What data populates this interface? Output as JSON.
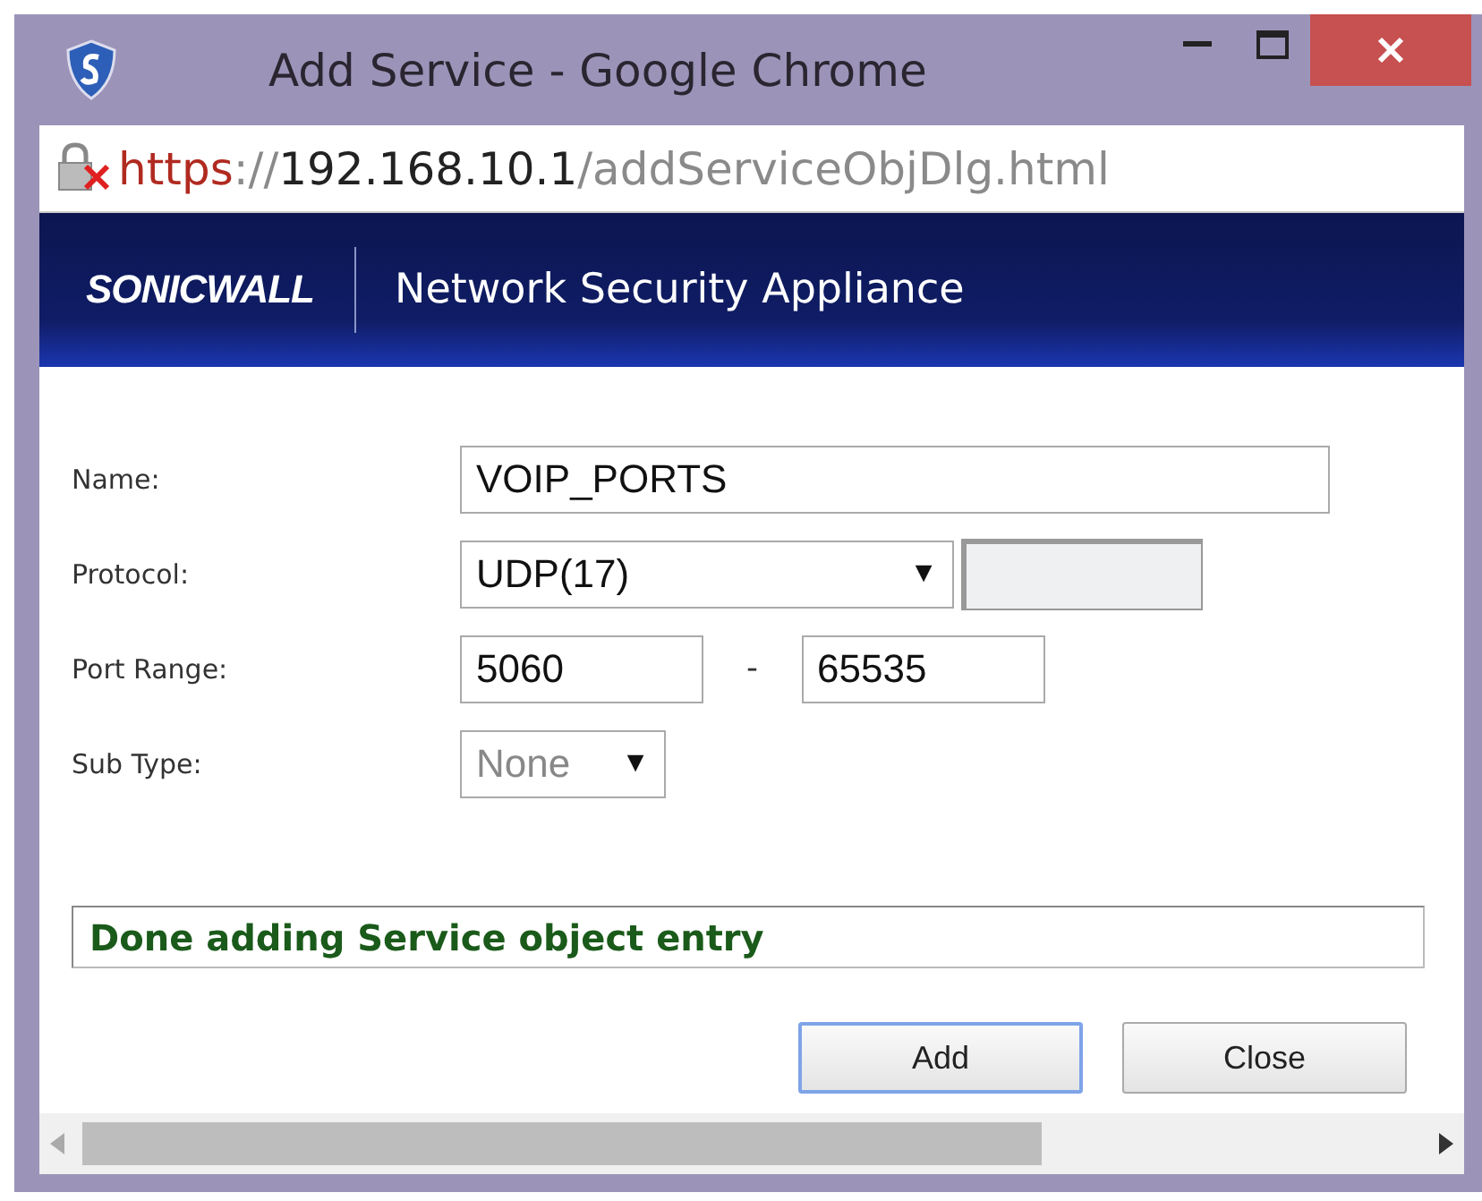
{
  "window": {
    "title": "Add Service - Google Chrome"
  },
  "address_bar": {
    "scheme": "https",
    "separator": "://",
    "host": "192.168.10.1",
    "path": "/addServiceObjDlg.html"
  },
  "banner": {
    "logo": "SONICWALL",
    "title": "Network Security Appliance"
  },
  "form": {
    "name": {
      "label": "Name:",
      "value": "VOIP_PORTS"
    },
    "protocol": {
      "label": "Protocol:",
      "value": "UDP(17)",
      "arrow": "▼",
      "extra_disabled": true
    },
    "port_range": {
      "label": "Port Range:",
      "start": "5060",
      "separator": "-",
      "end": "65535"
    },
    "sub_type": {
      "label": "Sub Type:",
      "value": "None",
      "arrow": "▼",
      "disabled": true
    }
  },
  "status": {
    "message": "Done adding Service object entry"
  },
  "buttons": [
    {
      "label": "Add",
      "focused": true
    },
    {
      "label": "Close",
      "focused": false
    }
  ]
}
